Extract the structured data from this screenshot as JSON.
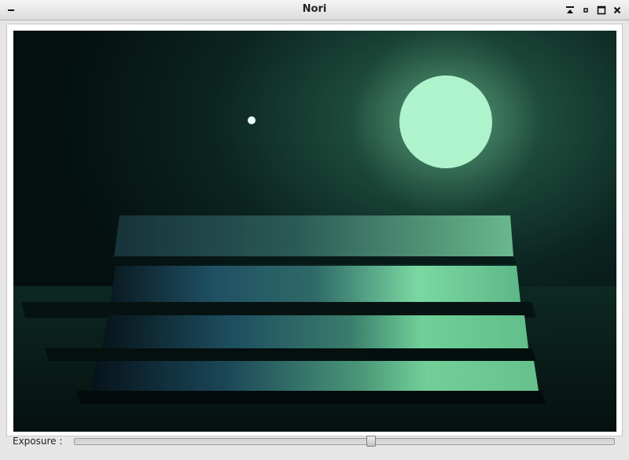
{
  "window": {
    "title": "Nori",
    "controls": {
      "menu_icon": "window-menu-icon",
      "shade_icon": "shade-icon",
      "minimize_icon": "minimize-icon",
      "maximize_icon": "maximize-icon",
      "close_icon": "close-icon"
    }
  },
  "render": {
    "description_colors": {
      "background_dark": "#061412",
      "light_color": "#aef3cc",
      "plate_blue": "#1f4f63",
      "plate_green": "#6fd197"
    }
  },
  "exposure": {
    "label": "Exposure :",
    "value": 0.55
  }
}
